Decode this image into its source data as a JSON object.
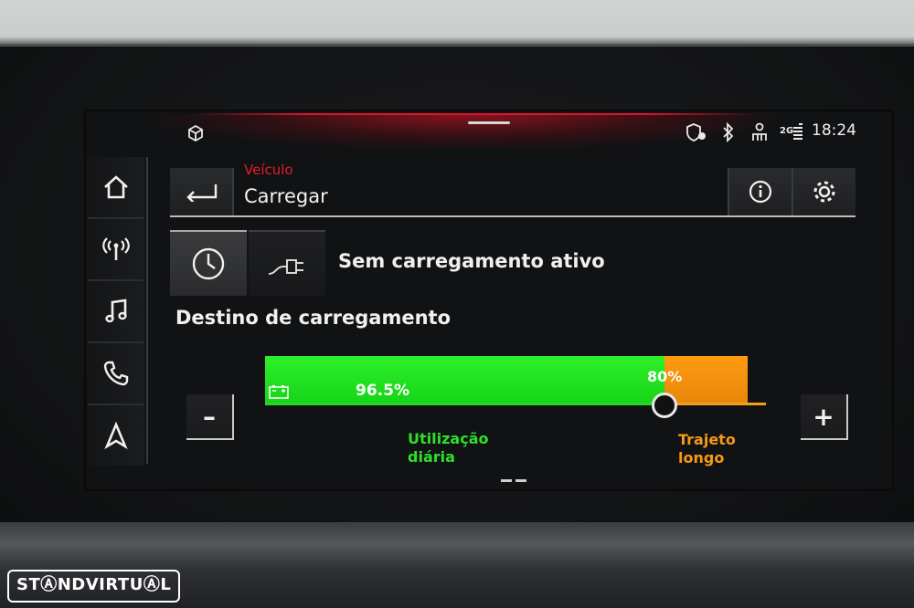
{
  "status_bar": {
    "time": "18:24",
    "network_label": "2G"
  },
  "nav": {
    "items": [
      {
        "icon": "home-icon"
      },
      {
        "icon": "radio-icon"
      },
      {
        "icon": "music-icon"
      },
      {
        "icon": "phone-icon"
      },
      {
        "icon": "navigation-icon"
      }
    ]
  },
  "header": {
    "subtitle": "Veículo",
    "title": "Carregar"
  },
  "charging": {
    "status": "Sem carregamento ativo",
    "section_title": "Destino de carregamento",
    "current_level": "96.5%",
    "target_level": "80%",
    "current_fraction": 0.965,
    "target_fraction": 0.8,
    "daily_label_line1": "Utilização",
    "daily_label_line2": "diária",
    "long_trip_label_line1": "Trajeto",
    "long_trip_label_line2": "longo",
    "decrease_label": "–",
    "increase_label": "+"
  },
  "colors": {
    "accent_red": "#e51c2a",
    "daily_green": "#2ee02a",
    "long_trip_orange": "#f59a14"
  },
  "watermark": "STⒶNDVIRTUⒶL"
}
